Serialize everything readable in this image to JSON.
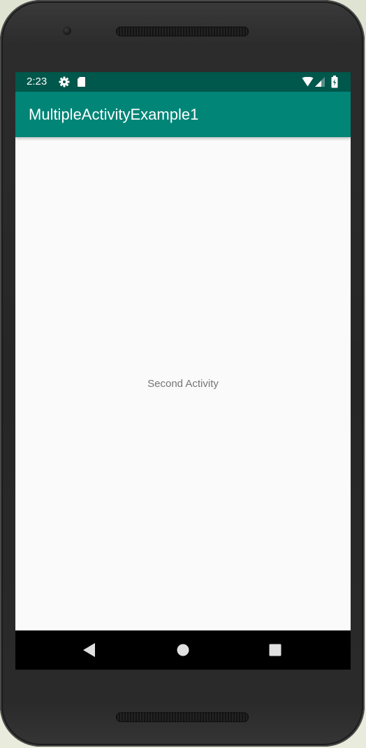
{
  "status_bar": {
    "time": "2:23",
    "icons": [
      "gear-icon",
      "sd-card-icon",
      "wifi-icon",
      "signal-icon",
      "battery-icon"
    ]
  },
  "app_bar": {
    "title": "MultipleActivityExample1"
  },
  "main": {
    "label": "Second Activity"
  },
  "nav_bar": {
    "icons": [
      "back-icon",
      "home-icon",
      "recents-icon"
    ]
  },
  "colors": {
    "status_bar": "#00574b",
    "app_bar": "#008577",
    "background": "#fafafa",
    "label_text": "#757575",
    "nav_bar": "#000000"
  }
}
